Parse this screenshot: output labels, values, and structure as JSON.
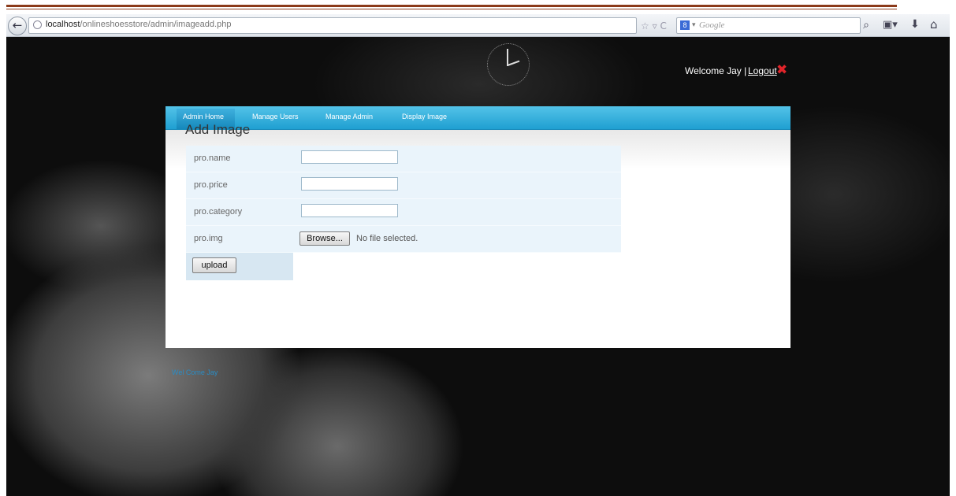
{
  "browser": {
    "url_host": "localhost",
    "url_path": "/onlineshoesstore/admin/imageadd.php",
    "search_placeholder": "Google",
    "search_engine_label": "8"
  },
  "header": {
    "welcome_text": "Welcome Jay |",
    "logout_label": "Logout"
  },
  "nav": {
    "items": [
      "Admin Home",
      "Manage Users",
      "Manage Admin",
      "Display Image"
    ],
    "active": "Admin Home"
  },
  "form": {
    "title": "Add Image",
    "fields": [
      {
        "label": "pro.name",
        "value": ""
      },
      {
        "label": "pro.price",
        "value": ""
      },
      {
        "label": "pro.category",
        "value": ""
      },
      {
        "label": "pro.img",
        "browse_label": "Browse...",
        "file_status": "No file selected."
      }
    ],
    "submit_label": "upload"
  },
  "footer": {
    "text": "Wel Come Jay"
  },
  "colors": {
    "nav_top": "#53c3e8",
    "nav_bottom": "#1f9fd1",
    "form_row_bg": "#eaf4fb",
    "logout_x": "#e0242a",
    "footer_link": "#2a8cc4"
  }
}
